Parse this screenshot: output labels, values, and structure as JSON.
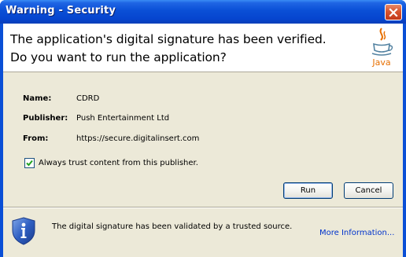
{
  "window": {
    "title": "Warning - Security"
  },
  "header": {
    "line1": "The application's digital signature has been verified.",
    "line2": "Do you want to run the application?",
    "logo_text": "Java",
    "logo_icon": "java-coffee-cup-icon"
  },
  "fields": [
    {
      "label": "Name:",
      "value": "CDRD"
    },
    {
      "label": "Publisher:",
      "value": "Push Entertainment Ltd"
    },
    {
      "label": "From:",
      "value": "https://secure.digitalinsert.com"
    }
  ],
  "trust_checkbox": {
    "label": "Always trust content from this publisher.",
    "checked": true
  },
  "buttons": {
    "run": "Run",
    "cancel": "Cancel"
  },
  "footer": {
    "icon": "info-shield-icon",
    "message": "The digital signature has been validated by a trusted source.",
    "link": "More Information..."
  },
  "colors": {
    "titlebar": "#0a4fd6",
    "dialog_bg": "#ece9d8",
    "link": "#0033cc",
    "java_orange": "#e76f00",
    "java_blue": "#5382a1"
  }
}
